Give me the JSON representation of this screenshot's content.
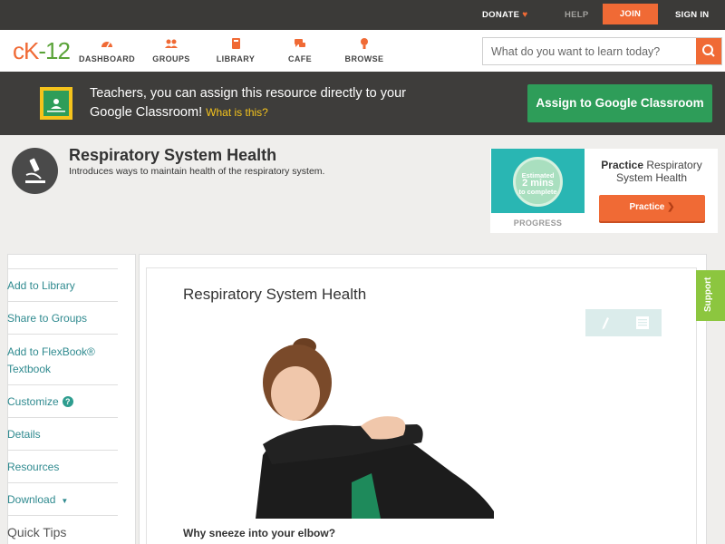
{
  "topbar": {
    "donate": "DONATE",
    "help": "HELP",
    "join": "JOIN",
    "signin": "SIGN IN"
  },
  "header": {
    "logo_c": "cK",
    "logo_k": "-12",
    "nav": [
      {
        "label": "DASHBOARD",
        "icon": "dashboard-icon"
      },
      {
        "label": "GROUPS",
        "icon": "groups-icon"
      },
      {
        "label": "LIBRARY",
        "icon": "library-icon"
      },
      {
        "label": "CAFE",
        "icon": "cafe-icon"
      },
      {
        "label": "BROWSE",
        "icon": "browse-icon"
      }
    ],
    "search_placeholder": "What do you want to learn today?"
  },
  "banner": {
    "text": "Teachers, you can assign this resource directly to your Google Classroom!",
    "what_link": "What is this?",
    "assign_button": "Assign to Google Classroom"
  },
  "concept": {
    "title": "Respiratory System Health",
    "subtitle": "Introduces ways to maintain health of the respiratory system."
  },
  "practice": {
    "estimated": "Estimated",
    "mins": "2 mins",
    "to_complete": "to complete",
    "progress_label": "PROGRESS",
    "title_bold": "Practice",
    "title_rest": "Respiratory System Health",
    "button": "Practice"
  },
  "sidebar": {
    "items": [
      {
        "label": "Add to Library"
      },
      {
        "label": "Share to Groups"
      },
      {
        "label": "Add to FlexBook® Textbook"
      },
      {
        "label": "Customize"
      },
      {
        "label": "Details"
      },
      {
        "label": "Resources"
      },
      {
        "label": "Download"
      }
    ],
    "quick_tips": "Quick Tips"
  },
  "content": {
    "title": "Respiratory System Health",
    "caption": "Why sneeze into your elbow?"
  },
  "support": "Support",
  "colors": {
    "accent": "#f06a35",
    "green": "#2e9d59",
    "teal": "#2f8a8f",
    "support": "#8cc63f"
  }
}
